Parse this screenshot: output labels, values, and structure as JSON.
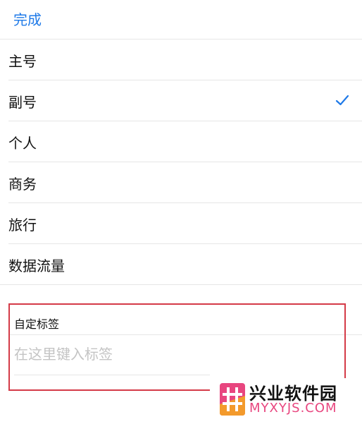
{
  "header": {
    "done_label": "完成"
  },
  "label_options": [
    {
      "label": "主号",
      "selected": false
    },
    {
      "label": "副号",
      "selected": true
    },
    {
      "label": "个人",
      "selected": false
    },
    {
      "label": "商务",
      "selected": false
    },
    {
      "label": "旅行",
      "selected": false
    },
    {
      "label": "数据流量",
      "selected": false
    }
  ],
  "custom_label": {
    "title": "自定标签",
    "input_value": "",
    "placeholder": "在这里键入标签"
  },
  "watermark": {
    "name": "兴业软件园",
    "url": "MYXYJS.COM"
  },
  "colors": {
    "accent": "#1f7ae8",
    "highlight": "#d43a47",
    "watermark_pink": "#e8467f",
    "watermark_orange": "#f39a2c"
  }
}
